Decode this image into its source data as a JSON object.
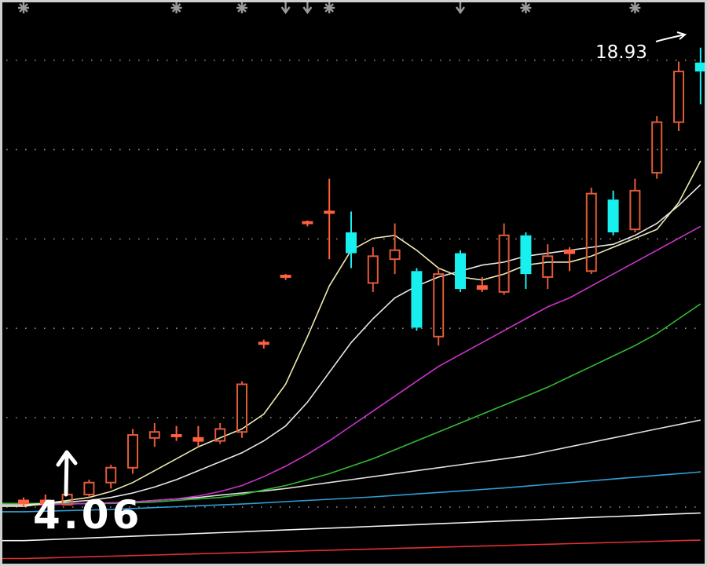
{
  "chart_data": {
    "type": "candlestick",
    "grid": true,
    "annotations": {
      "high_label": "18.93",
      "low_label": "4.06"
    },
    "colors": {
      "up": "#e25a3a",
      "down": "#18f0f0",
      "doji": "#ff6040",
      "ma5": "#f0e8b0",
      "ma10": "#e8e8e8",
      "ma20": "#cc33cc",
      "ma30": "#33bb33",
      "ma60": "#e0e0e0",
      "ma90": "#2f9fd6",
      "ma120": "#f2f2f2",
      "ma250": "#e03030"
    },
    "candles": [
      {
        "o": 4.1,
        "h": 4.3,
        "l": 4.0,
        "c": 4.2
      },
      {
        "o": 4.2,
        "h": 4.4,
        "l": 4.0,
        "c": 4.1
      },
      {
        "o": 4.06,
        "h": 4.5,
        "l": 4.05,
        "c": 4.4
      },
      {
        "o": 4.4,
        "h": 4.9,
        "l": 4.3,
        "c": 4.8
      },
      {
        "o": 4.8,
        "h": 5.4,
        "l": 4.6,
        "c": 5.3
      },
      {
        "o": 5.3,
        "h": 6.6,
        "l": 5.1,
        "c": 6.4
      },
      {
        "o": 6.3,
        "h": 6.8,
        "l": 6.0,
        "c": 6.5
      },
      {
        "o": 6.4,
        "h": 6.7,
        "l": 6.2,
        "c": 6.35
      },
      {
        "o": 6.3,
        "h": 6.7,
        "l": 6.0,
        "c": 6.2
      },
      {
        "o": 6.2,
        "h": 6.8,
        "l": 6.1,
        "c": 6.6
      },
      {
        "o": 6.5,
        "h": 8.2,
        "l": 6.3,
        "c": 8.1
      },
      {
        "o": 9.5,
        "h": 9.6,
        "l": 9.3,
        "c": 9.45
      },
      {
        "o": 11.7,
        "h": 11.8,
        "l": 11.6,
        "c": 11.75
      },
      {
        "o": 13.5,
        "h": 13.6,
        "l": 13.4,
        "c": 13.55
      },
      {
        "o": 13.9,
        "h": 15.0,
        "l": 12.3,
        "c": 13.85
      },
      {
        "o": 13.2,
        "h": 13.9,
        "l": 12.0,
        "c": 12.5
      },
      {
        "o": 11.5,
        "h": 12.7,
        "l": 11.2,
        "c": 12.4
      },
      {
        "o": 12.3,
        "h": 13.5,
        "l": 11.8,
        "c": 12.6
      },
      {
        "o": 11.9,
        "h": 12.0,
        "l": 9.9,
        "c": 10.0
      },
      {
        "o": 9.7,
        "h": 12.0,
        "l": 9.4,
        "c": 11.8
      },
      {
        "o": 12.5,
        "h": 12.6,
        "l": 11.2,
        "c": 11.3
      },
      {
        "o": 11.4,
        "h": 11.7,
        "l": 11.2,
        "c": 11.3
      },
      {
        "o": 11.2,
        "h": 13.5,
        "l": 11.1,
        "c": 13.1
      },
      {
        "o": 13.1,
        "h": 13.2,
        "l": 11.3,
        "c": 11.8
      },
      {
        "o": 11.7,
        "h": 12.8,
        "l": 11.3,
        "c": 12.4
      },
      {
        "o": 12.6,
        "h": 12.7,
        "l": 11.9,
        "c": 12.5
      },
      {
        "o": 11.9,
        "h": 14.7,
        "l": 11.8,
        "c": 14.5
      },
      {
        "o": 14.3,
        "h": 14.6,
        "l": 13.1,
        "c": 13.2
      },
      {
        "o": 13.3,
        "h": 15.0,
        "l": 13.2,
        "c": 14.6
      },
      {
        "o": 15.2,
        "h": 17.1,
        "l": 15.0,
        "c": 16.9
      },
      {
        "o": 16.9,
        "h": 18.93,
        "l": 16.6,
        "c": 18.6
      },
      {
        "o": 18.9,
        "h": 19.4,
        "l": 17.5,
        "c": 18.6
      }
    ],
    "ma_lines": {
      "ma5": [
        4.0,
        4.1,
        4.2,
        4.3,
        4.5,
        4.8,
        5.2,
        5.6,
        6.0,
        6.3,
        6.6,
        7.1,
        8.1,
        9.7,
        11.4,
        12.6,
        13.0,
        13.1,
        12.6,
        12.0,
        11.7,
        11.6,
        11.8,
        12.1,
        12.2,
        12.2,
        12.4,
        12.7,
        13.0,
        13.3,
        14.2,
        15.6
      ],
      "ma10": [
        4.05,
        4.1,
        4.15,
        4.2,
        4.3,
        4.45,
        4.65,
        4.9,
        5.2,
        5.5,
        5.8,
        6.2,
        6.7,
        7.5,
        8.5,
        9.5,
        10.3,
        11.0,
        11.4,
        11.7,
        11.9,
        12.1,
        12.2,
        12.4,
        12.5,
        12.6,
        12.7,
        12.8,
        13.1,
        13.5,
        14.1,
        14.8
      ],
      "ma20": [
        4.05,
        4.06,
        4.08,
        4.1,
        4.12,
        4.15,
        4.2,
        4.25,
        4.35,
        4.5,
        4.7,
        5.0,
        5.35,
        5.75,
        6.2,
        6.7,
        7.2,
        7.7,
        8.2,
        8.7,
        9.1,
        9.5,
        9.9,
        10.3,
        10.7,
        11.0,
        11.4,
        11.8,
        12.2,
        12.6,
        13.0,
        13.4
      ],
      "ma30": [
        4.1,
        4.1,
        4.1,
        4.1,
        4.1,
        4.12,
        4.15,
        4.2,
        4.25,
        4.3,
        4.4,
        4.55,
        4.7,
        4.9,
        5.1,
        5.35,
        5.6,
        5.9,
        6.2,
        6.5,
        6.8,
        7.1,
        7.4,
        7.7,
        8.0,
        8.35,
        8.7,
        9.05,
        9.4,
        9.8,
        10.3,
        10.8
      ],
      "ma60": [
        4.05,
        4.06,
        4.08,
        4.1,
        4.12,
        4.15,
        4.2,
        4.25,
        4.3,
        4.38,
        4.45,
        4.52,
        4.6,
        4.7,
        4.8,
        4.9,
        5.0,
        5.1,
        5.2,
        5.3,
        5.4,
        5.5,
        5.6,
        5.7,
        5.85,
        6.0,
        6.15,
        6.3,
        6.45,
        6.6,
        6.75,
        6.9
      ],
      "ma90": [
        3.82,
        3.84,
        3.86,
        3.88,
        3.9,
        3.93,
        3.96,
        3.99,
        4.02,
        4.05,
        4.08,
        4.12,
        4.16,
        4.2,
        4.24,
        4.28,
        4.32,
        4.37,
        4.42,
        4.47,
        4.52,
        4.57,
        4.62,
        4.68,
        4.74,
        4.8,
        4.86,
        4.92,
        4.98,
        5.04,
        5.1,
        5.16
      ],
      "ma120": [
        2.85,
        2.88,
        2.91,
        2.94,
        2.97,
        3.0,
        3.03,
        3.06,
        3.09,
        3.12,
        3.15,
        3.18,
        3.21,
        3.24,
        3.27,
        3.3,
        3.33,
        3.36,
        3.39,
        3.42,
        3.45,
        3.48,
        3.51,
        3.54,
        3.57,
        3.6,
        3.63,
        3.66,
        3.69,
        3.72,
        3.75,
        3.78
      ],
      "ma250": [
        2.25,
        2.27,
        2.29,
        2.31,
        2.33,
        2.35,
        2.37,
        2.39,
        2.41,
        2.43,
        2.45,
        2.47,
        2.49,
        2.51,
        2.53,
        2.55,
        2.57,
        2.59,
        2.61,
        2.63,
        2.65,
        2.67,
        2.69,
        2.71,
        2.73,
        2.75,
        2.77,
        2.79,
        2.81,
        2.83,
        2.85,
        2.87
      ]
    },
    "ylim": [
      2.0,
      21.0
    ],
    "event_markers": [
      {
        "index": 0,
        "kind": "star"
      },
      {
        "index": 7,
        "kind": "star"
      },
      {
        "index": 10,
        "kind": "star"
      },
      {
        "index": 12,
        "kind": "arrow"
      },
      {
        "index": 13,
        "kind": "arrow"
      },
      {
        "index": 14,
        "kind": "star"
      },
      {
        "index": 20,
        "kind": "arrow"
      },
      {
        "index": 23,
        "kind": "star"
      },
      {
        "index": 28,
        "kind": "star"
      }
    ]
  }
}
